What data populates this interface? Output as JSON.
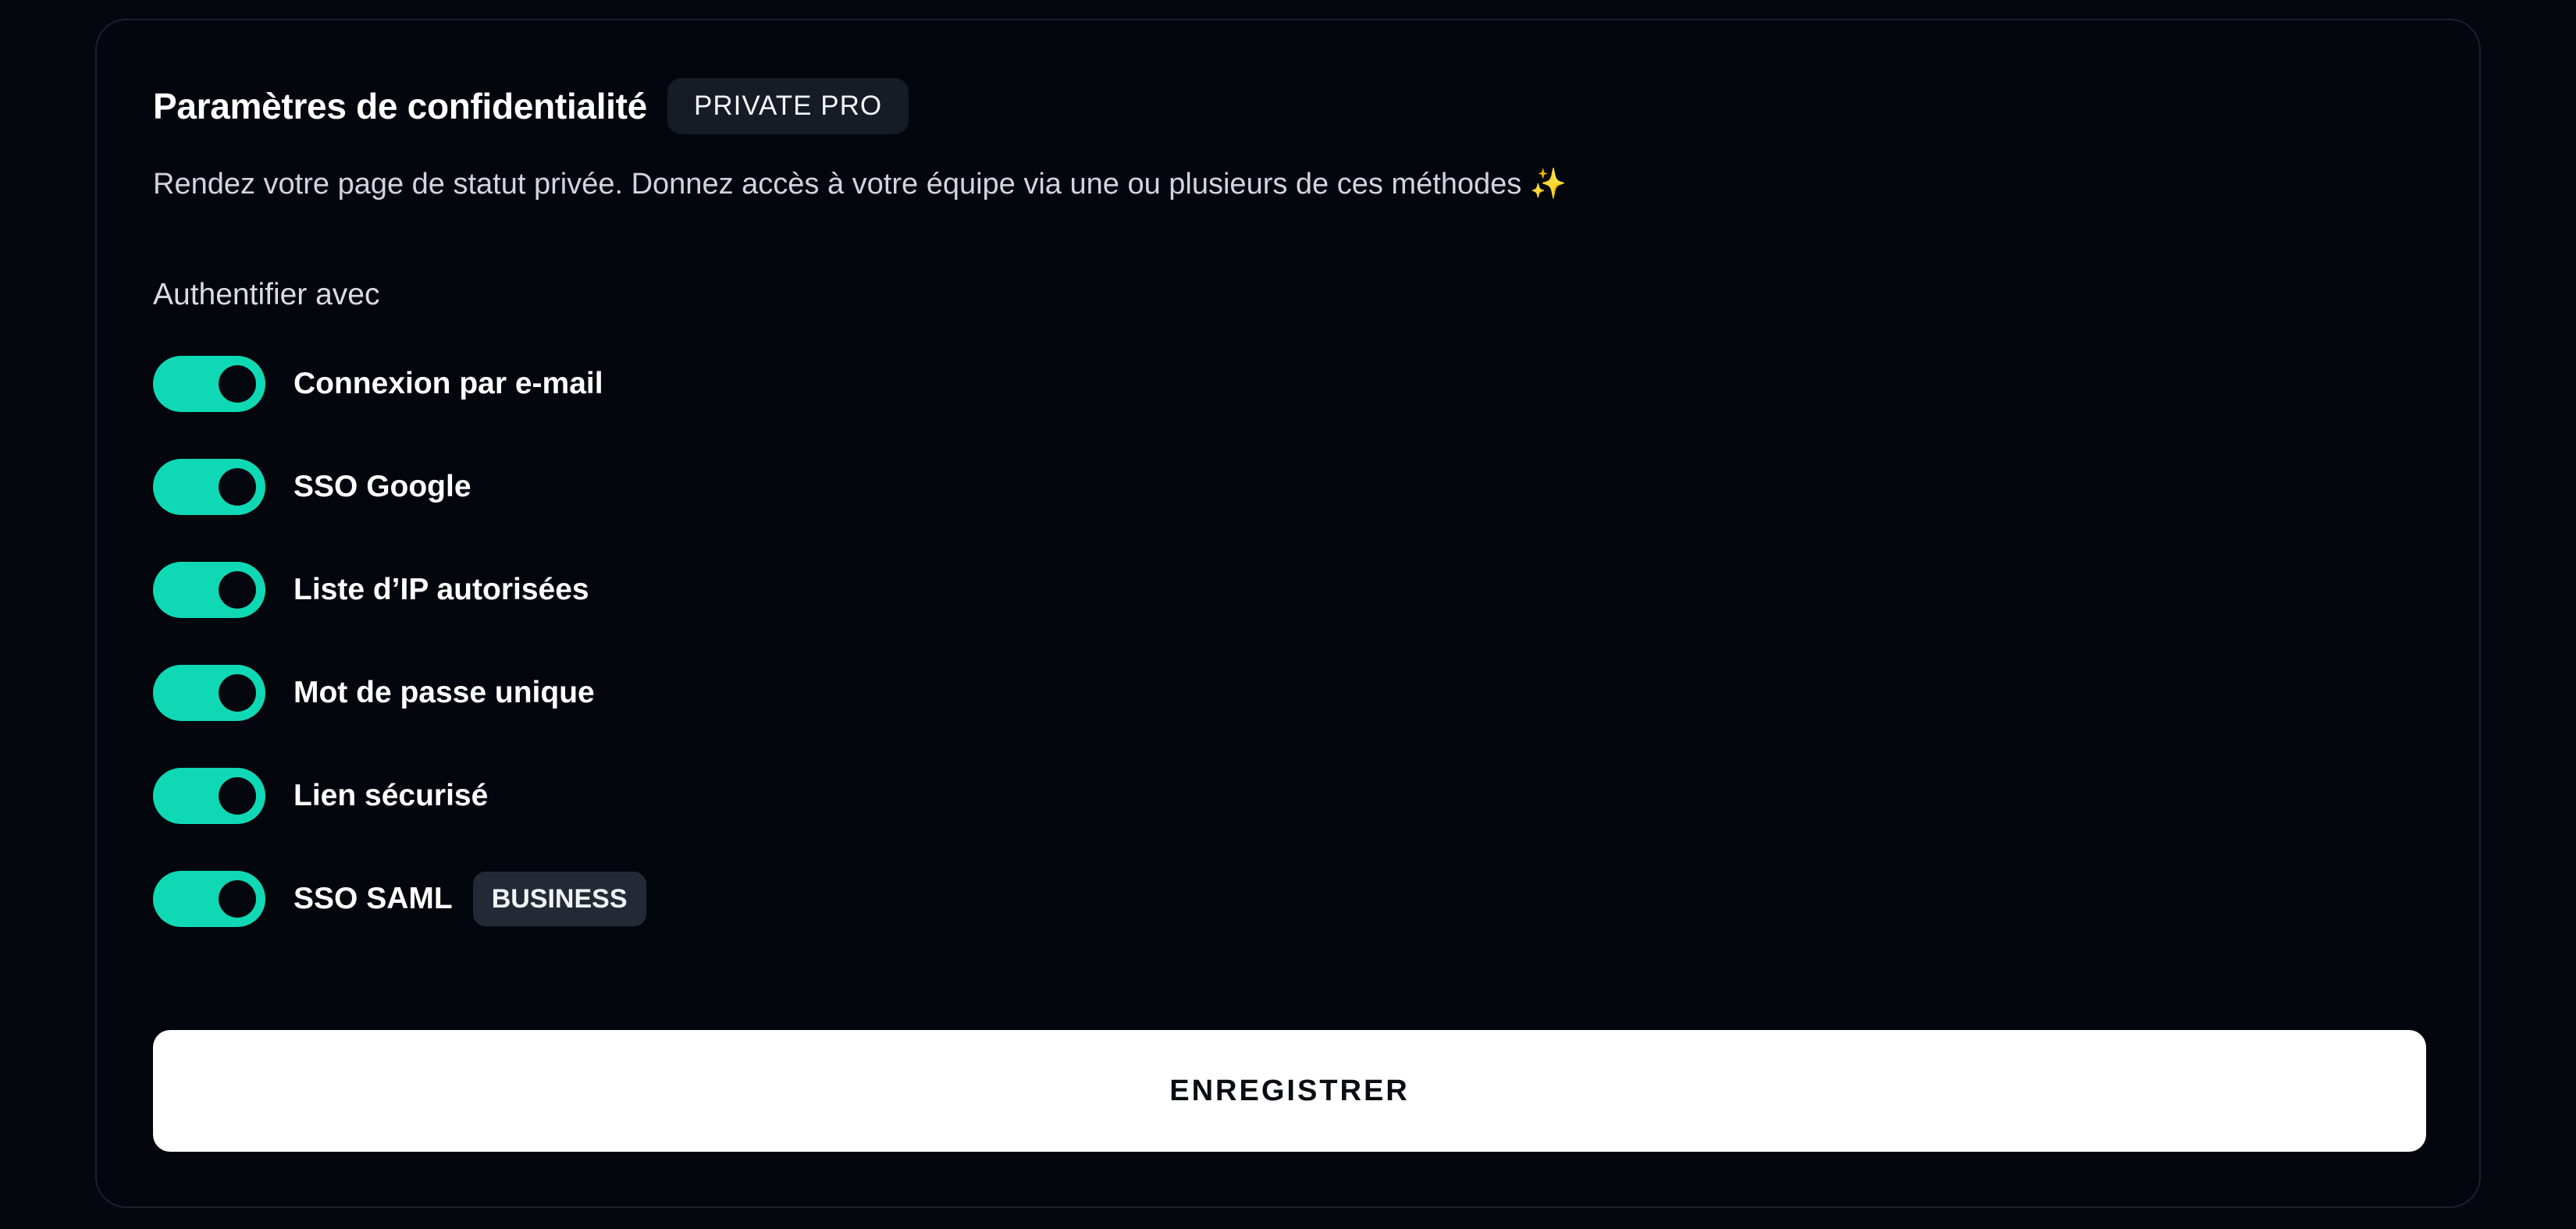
{
  "header": {
    "title": "Paramètres de confidentialité",
    "badge": "PRIVATE PRO",
    "subtitle": "Rendez votre page de statut privée. Donnez accès à votre équipe via une ou plusieurs de ces méthodes",
    "subtitle_emoji": "✨"
  },
  "auth": {
    "label": "Authentifier avec",
    "options": [
      {
        "label": "Connexion par e-mail",
        "enabled": true
      },
      {
        "label": "SSO Google",
        "enabled": true
      },
      {
        "label": "Liste d’IP autorisées",
        "enabled": true
      },
      {
        "label": "Mot de passe unique",
        "enabled": true
      },
      {
        "label": "Lien sécurisé",
        "enabled": true
      },
      {
        "label": "SSO SAML",
        "enabled": true,
        "badge": "BUSINESS"
      }
    ]
  },
  "actions": {
    "save_label": "ENREGISTRER"
  },
  "colors": {
    "background": "#05070e",
    "toggle_on": "#0fd9b5",
    "card_border": "#1c212b"
  }
}
